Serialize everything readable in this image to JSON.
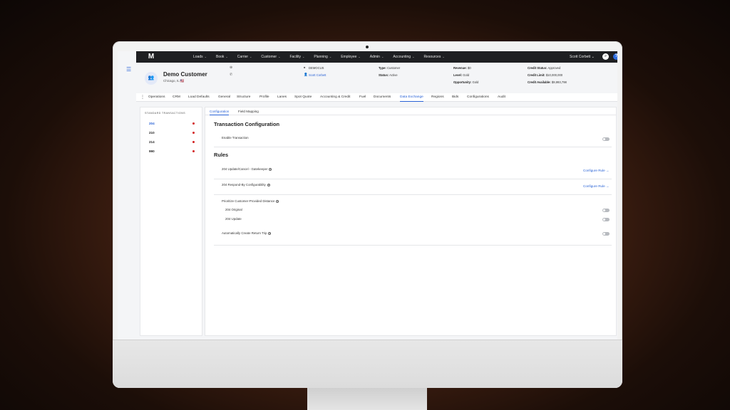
{
  "nav": {
    "menu": [
      "Loads",
      "Book",
      "Carrier",
      "Customer",
      "Facility",
      "Planning",
      "Employee",
      "Admin",
      "Accounting",
      "Resources"
    ],
    "user": "Scott Corbett",
    "help_label": "?"
  },
  "header": {
    "avatar_text": "👥",
    "customer_name": "Demo Customer",
    "customer_city": "Chicago, IL 🇺🇸",
    "code": "DEMOCUS",
    "rep": "Scott Corbett",
    "type_label": "Type:",
    "type_value": "Customer",
    "status_label": "Status:",
    "status_value": "Active",
    "revenue_label": "Revenue:",
    "revenue_value": "$0",
    "level_label": "Level:",
    "level_value": "Gold",
    "opportunity_label": "Opportunity:",
    "opportunity_value": "Gold",
    "credit_status_label": "Credit Status:",
    "credit_status_value": "Approved",
    "credit_limit_label": "Credit Limit:",
    "credit_limit_value": "$10,000,000",
    "credit_available_label": "Credit Available:",
    "credit_available_value": "$9,993,798"
  },
  "tabs": [
    "Operations",
    "CRM",
    "Load Defaults",
    "General",
    "Structure",
    "Profile",
    "Lanes",
    "Spot Quote",
    "Accounting & Credit",
    "Fuel",
    "Documents",
    "Data Exchange",
    "Regions",
    "Bids",
    "Configurations",
    "Audit"
  ],
  "left_panel": {
    "title": "STANDARD TRANSACTIONS",
    "items": [
      "204",
      "210",
      "214",
      "990"
    ]
  },
  "subtabs": [
    "Configuration",
    "Field Mapping"
  ],
  "main": {
    "transaction_title": "Transaction Configuration",
    "enable_label": "Enable Transaction",
    "rules_title": "Rules",
    "rule1": "204 Update/Cancel - Gatekeeper",
    "rule2": "204 Respond-By Configurability",
    "configure_label": "Configure Rule →",
    "rule3": "Prioritize Customer-Provided Distance",
    "rule3_sub1": "204 Original",
    "rule3_sub2": "204 Update",
    "rule4": "Automatically Create Return Trip",
    "q": "?"
  },
  "colors": {
    "accent": "#2a63d6",
    "nav_bg": "#1e1f22",
    "alert_dot": "#d21f1f"
  }
}
